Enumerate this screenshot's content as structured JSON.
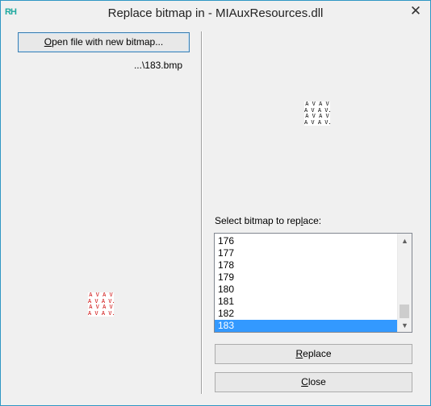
{
  "window": {
    "title": "Replace bitmap in - MIAuxResources.dll",
    "app_icon_text": "RH",
    "close_glyph": "✕"
  },
  "left": {
    "open_button": {
      "accel": "O",
      "rest": "pen file with new bitmap..."
    },
    "file_path": "...\\183.bmp",
    "preview_lines": [
      "A V A V",
      "A V A V.",
      "A V A V",
      "A V A V."
    ]
  },
  "right": {
    "preview_lines": [
      "A V A V",
      "A V A V.",
      "A V A V",
      "A V A V."
    ],
    "select_label": {
      "before": "Select bitmap to rep",
      "accel": "l",
      "after": "ace:"
    },
    "list_items": [
      "176",
      "177",
      "178",
      "179",
      "180",
      "181",
      "182",
      "183"
    ],
    "selected_item": "183",
    "replace_button": {
      "accel": "R",
      "rest": "eplace"
    },
    "close_button": {
      "accel": "C",
      "rest": "lose"
    },
    "scroll_up": "▲",
    "scroll_down": "▼"
  },
  "colors": {
    "selection": "#3399ff",
    "preview_left_glyph": "#cc0000",
    "preview_right_glyph": "#000000"
  }
}
